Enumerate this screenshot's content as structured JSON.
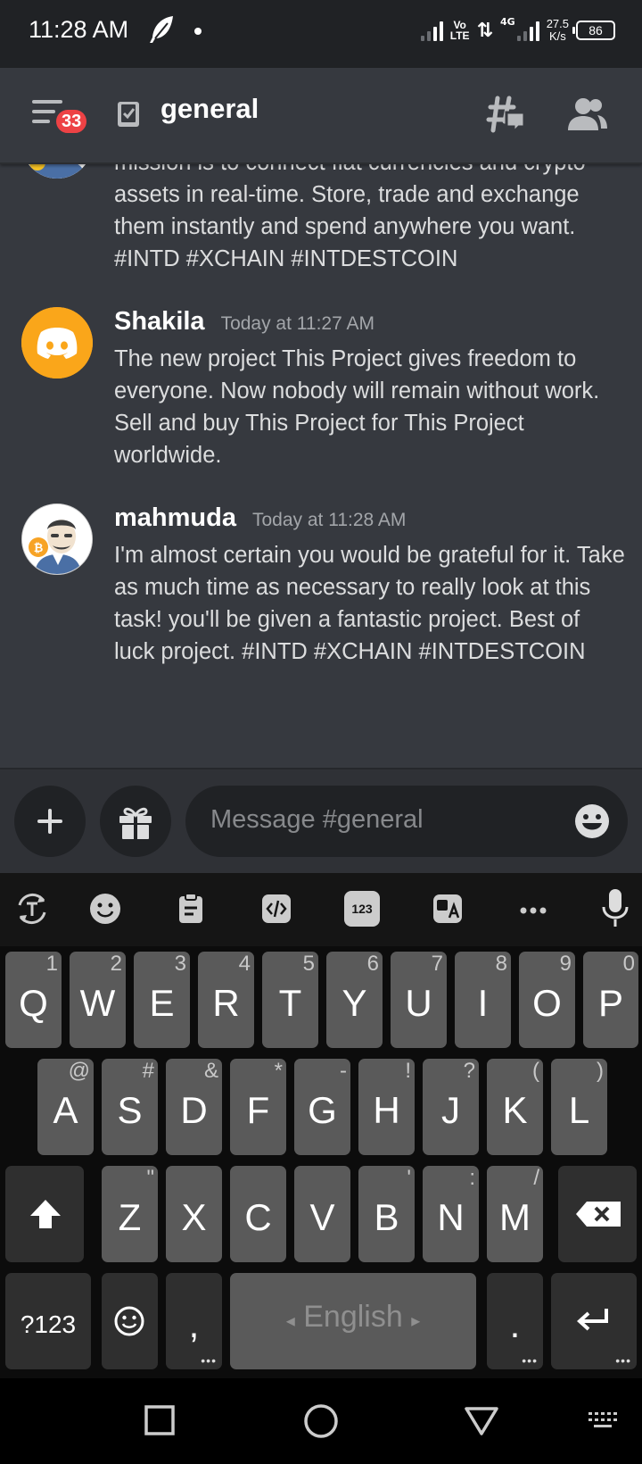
{
  "status": {
    "time": "11:28 AM",
    "volte_top": "Vo",
    "volte_bottom": "LTE",
    "net_type": "4G",
    "speed_value": "27.5",
    "speed_unit": "K/s",
    "battery": "86"
  },
  "header": {
    "unread_badge": "33",
    "channel_name": "general"
  },
  "messages": [
    {
      "author": "",
      "timestamp": "",
      "text": "mission is to connect fiat currencies and crypto assets in real-time. Store, trade and exchange them instantly and spend anywhere you want. #INTD #XCHAIN  #INTDESTCOIN"
    },
    {
      "author": "Shakila",
      "timestamp": "Today at 11:27 AM",
      "text": "The new project This Project gives freedom to everyone. Now nobody will remain without work. Sell and buy This Project for This Project worldwide."
    },
    {
      "author": "mahmuda",
      "timestamp": "Today at 11:28 AM",
      "text": "I'm almost certain you would be grateful for it. Take as much time as necessary to really look at this task! you'll be given a fantastic project. Best of luck project. #INTD #XCHAIN #INTDESTCOIN"
    }
  ],
  "composer": {
    "placeholder": "Message #general"
  },
  "keyboard": {
    "toolbar": {
      "numbers_label": "123"
    },
    "row1": [
      {
        "key": "Q",
        "hint": "1"
      },
      {
        "key": "W",
        "hint": "2"
      },
      {
        "key": "E",
        "hint": "3"
      },
      {
        "key": "R",
        "hint": "4"
      },
      {
        "key": "T",
        "hint": "5"
      },
      {
        "key": "Y",
        "hint": "6"
      },
      {
        "key": "U",
        "hint": "7"
      },
      {
        "key": "I",
        "hint": "8"
      },
      {
        "key": "O",
        "hint": "9"
      },
      {
        "key": "P",
        "hint": "0"
      }
    ],
    "row2": [
      {
        "key": "A",
        "hint": "@"
      },
      {
        "key": "S",
        "hint": "#"
      },
      {
        "key": "D",
        "hint": "&"
      },
      {
        "key": "F",
        "hint": "*"
      },
      {
        "key": "G",
        "hint": "-"
      },
      {
        "key": "H",
        "hint": "!"
      },
      {
        "key": "J",
        "hint": "?"
      },
      {
        "key": "K",
        "hint": "("
      },
      {
        "key": "L",
        "hint": ")"
      }
    ],
    "row3": [
      {
        "key": "Z",
        "hint": "\""
      },
      {
        "key": "X",
        "hint": ""
      },
      {
        "key": "C",
        "hint": ""
      },
      {
        "key": "V",
        "hint": ""
      },
      {
        "key": "B",
        "hint": "'"
      },
      {
        "key": "N",
        "hint": ":"
      },
      {
        "key": "M",
        "hint": "/"
      }
    ],
    "symbols_label": "?123",
    "comma_label": ",",
    "space_label": "English",
    "period_label": "."
  },
  "colors": {
    "background": "#36393f",
    "composer": "#2f3136",
    "accent_orange": "#faa61a",
    "badge_red": "#ed4245"
  }
}
